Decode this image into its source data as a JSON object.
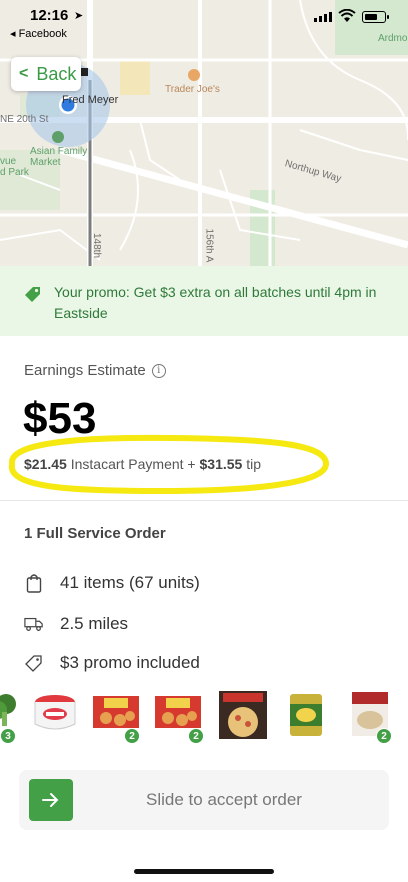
{
  "status_bar": {
    "time": "12:16",
    "back_app": "◂ Facebook"
  },
  "map": {
    "back_label": "Back",
    "labels": {
      "fred_meyer": "Fred Meyer",
      "trader_joes": "Trader Joe's",
      "ne_20th": "NE 20th St",
      "asian_family_market": "Asian Family\nMarket",
      "bellevue_park": "vue\nd Park",
      "northup_way": "Northup Way",
      "ardmore": "Ardmo",
      "street_148": "148th",
      "street_156": "156th A"
    }
  },
  "promo": {
    "text": "Your promo: Get $3 extra on all batches until 4pm in Eastside",
    "icon": "tag-icon"
  },
  "earnings": {
    "label": "Earnings Estimate",
    "amount": "$53",
    "instacart_payment": "$21.45",
    "payment_label": " Instacart Payment + ",
    "tip": "$31.55",
    "tip_label": " tip"
  },
  "order": {
    "title": "1 Full Service Order",
    "items": "41 items (67 units)",
    "distance": "2.5 miles",
    "promo_included": "$3 promo included"
  },
  "thumbnails": [
    {
      "name": "broccoli",
      "badge": "3"
    },
    {
      "name": "sour-cream",
      "badge": ""
    },
    {
      "name": "totinos-pizza-rolls-1",
      "badge": "2"
    },
    {
      "name": "totinos-pizza-rolls-2",
      "badge": "2"
    },
    {
      "name": "red-baron-pizza",
      "badge": ""
    },
    {
      "name": "canned-corn",
      "badge": ""
    },
    {
      "name": "ramen-bowl",
      "badge": "2"
    }
  ],
  "slider": {
    "label": "Slide to accept order"
  },
  "colors": {
    "accent": "#43a047",
    "promo_bg": "#eaf6e6",
    "promo_text": "#2f7a3a",
    "highlight": "#f5e911"
  }
}
